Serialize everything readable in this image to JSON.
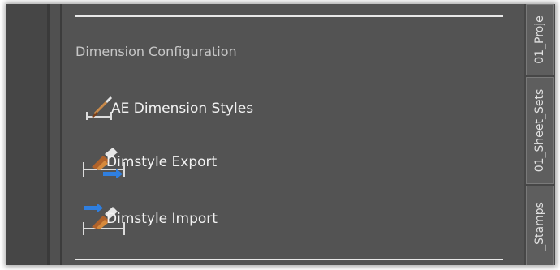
{
  "palette": {
    "section_title": "Dimension Configuration",
    "tools": [
      {
        "label": "AE Dimension Styles",
        "icon": "dimension-styles-icon"
      },
      {
        "label": "Dimstyle Export",
        "icon": "dimstyle-export-icon"
      },
      {
        "label": "Dimstyle Import",
        "icon": "dimstyle-import-icon"
      }
    ]
  },
  "tabs": [
    {
      "label": "01_Proje"
    },
    {
      "label": "01_Sheet_Sets"
    },
    {
      "label": "_Stamps"
    }
  ],
  "colors": {
    "panel_bg": "#535353",
    "text": "#f2f2f2",
    "section_text": "#c7c7c7",
    "arrow_blue": "#2f7fe0",
    "brush_brown": "#b0622a"
  }
}
